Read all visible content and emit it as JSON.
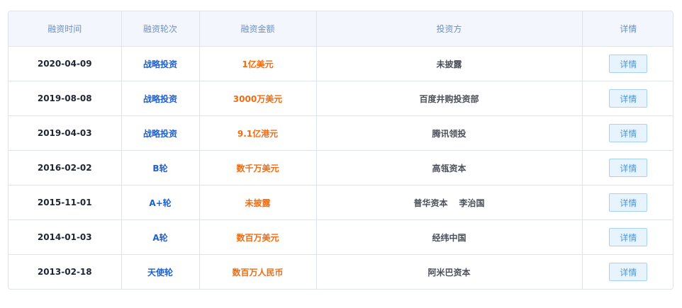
{
  "table": {
    "headers": [
      "融资时间",
      "融资轮次",
      "融资金额",
      "投资方",
      "详情"
    ],
    "rows": [
      {
        "date": "2020-04-09",
        "round": "战略投资",
        "amount": "1亿美元",
        "investors": [
          "未披露"
        ],
        "detail_label": "详情"
      },
      {
        "date": "2019-08-08",
        "round": "战略投资",
        "amount": "3000万美元",
        "investors": [
          "百度井购投资部"
        ],
        "detail_label": "详情"
      },
      {
        "date": "2019-04-03",
        "round": "战略投资",
        "amount": "9.1亿港元",
        "investors": [
          "腾讯领投"
        ],
        "detail_label": "详情"
      },
      {
        "date": "2016-02-02",
        "round": "B轮",
        "amount": "数千万美元",
        "investors": [
          "高瓴资本"
        ],
        "detail_label": "详情"
      },
      {
        "date": "2015-11-01",
        "round": "A+轮",
        "amount": "未披露",
        "investors": [
          "普华资本",
          "李治国"
        ],
        "detail_label": "详情"
      },
      {
        "date": "2014-01-03",
        "round": "A轮",
        "amount": "数百万美元",
        "investors": [
          "经纬中国"
        ],
        "detail_label": "详情"
      },
      {
        "date": "2013-02-18",
        "round": "天使轮",
        "amount": "数百万人民币",
        "investors": [
          "阿米巴资本"
        ],
        "detail_label": "详情"
      }
    ]
  },
  "colors": {
    "header_bg": "#f3f7fd",
    "header_text": "#6b8fc4",
    "round_text": "#1f5fcf",
    "amount_text": "#f26c12",
    "button_bg": "#e7f3fd",
    "button_border": "#a9d2f2",
    "button_text": "#4e96d6"
  }
}
